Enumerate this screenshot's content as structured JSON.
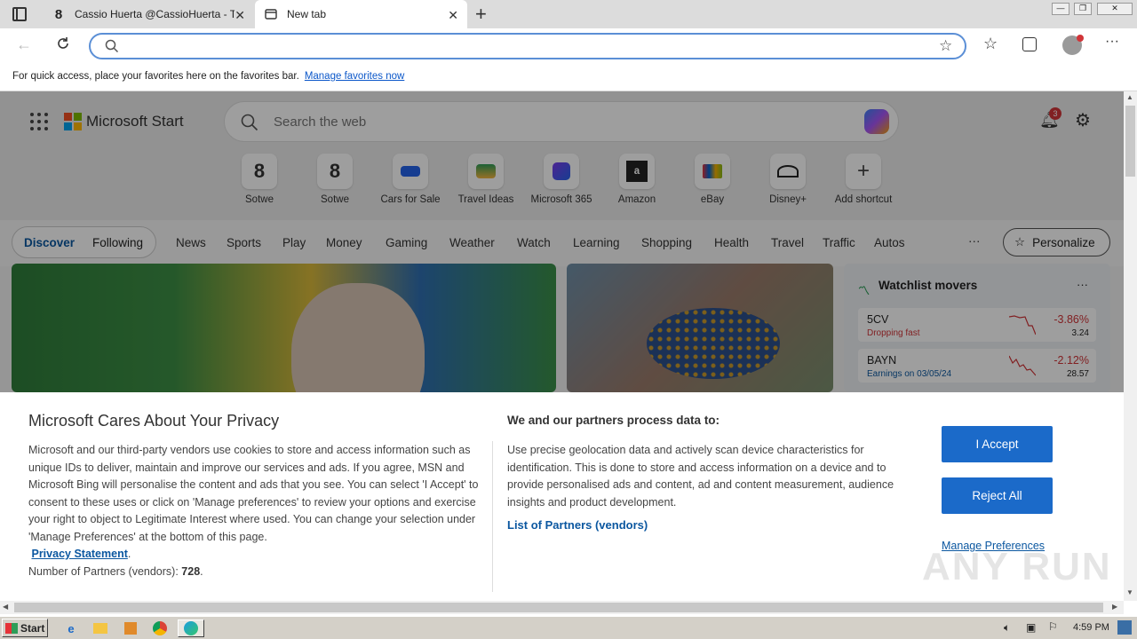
{
  "tabs": [
    {
      "title": "Cassio Huerta @CassioHuerta - T",
      "active": false
    },
    {
      "title": "New tab",
      "active": true
    }
  ],
  "window_controls": {
    "minimize": "—",
    "restore": "❐",
    "close": "✕"
  },
  "toolbar": {
    "address_value": "",
    "new_tab_symbol": "+"
  },
  "favbar": {
    "message": "For quick access, place your favorites here on the favorites bar.",
    "link": "Manage favorites now"
  },
  "start": {
    "brand": "Microsoft Start",
    "search_placeholder": "Search the web",
    "notification_count": "3",
    "shortcuts": [
      {
        "label": "Sotwe",
        "icon": "sotwe-icon"
      },
      {
        "label": "Sotwe",
        "icon": "sotwe-icon"
      },
      {
        "label": "Cars for Sale",
        "icon": "car-icon"
      },
      {
        "label": "Travel Ideas",
        "icon": "island-icon"
      },
      {
        "label": "Microsoft 365",
        "icon": "m365-icon"
      },
      {
        "label": "Amazon",
        "icon": "amazon-icon"
      },
      {
        "label": "eBay",
        "icon": "ebay-icon"
      },
      {
        "label": "Disney+",
        "icon": "disney-icon"
      },
      {
        "label": "Add shortcut",
        "icon": "plus-icon"
      }
    ],
    "feed_tabs": [
      "Discover",
      "Following"
    ],
    "nav": [
      "News",
      "Sports",
      "Play",
      "Money",
      "Gaming",
      "Weather",
      "Watch",
      "Learning",
      "Shopping",
      "Health",
      "Travel",
      "Traffic",
      "Autos"
    ],
    "more": "···",
    "personalize": "Personalize",
    "watchlist": {
      "title": "Watchlist movers",
      "more": "···",
      "rows": [
        {
          "ticker": "5CV",
          "sub": "Dropping fast",
          "change": "-3.86%",
          "price": "3.24"
        },
        {
          "ticker": "BAYN",
          "sub": "Earnings on 03/05/24",
          "change": "-2.12%",
          "price": "28.57"
        }
      ]
    }
  },
  "cookie": {
    "title": "Microsoft Cares About Your Privacy",
    "body": "Microsoft and our third-party vendors use cookies to store and access information such as unique IDs to deliver, maintain and improve our services and ads. If you agree, MSN and Microsoft Bing will personalise the content and ads that you see. You can select 'I Accept' to consent to these uses or click on 'Manage preferences' to review your options and exercise your right to object to Legitimate Interest where used.  You can change your selection under 'Manage Preferences' at the bottom of this page.",
    "privacy_link": "Privacy Statement",
    "partners_label": "Number of Partners (vendors):",
    "partners_count": "728",
    "purpose_title": "We and our partners process data to:",
    "purpose_body": "Use precise geolocation data and actively scan device characteristics for identification. This is done to store and access information on a device and to provide personalised ads and content, ad and content measurement, audience insights and product development.",
    "list_link": "List of Partners (vendors)",
    "accept": "I Accept",
    "reject": "Reject All",
    "manage": "Manage Preferences"
  },
  "watermark": "ANY RUN",
  "taskbar": {
    "start": "Start",
    "time": "4:59 PM"
  },
  "colors": {
    "accent": "#1b6ac9",
    "link": "#0b57a0",
    "negative": "#d13438"
  }
}
